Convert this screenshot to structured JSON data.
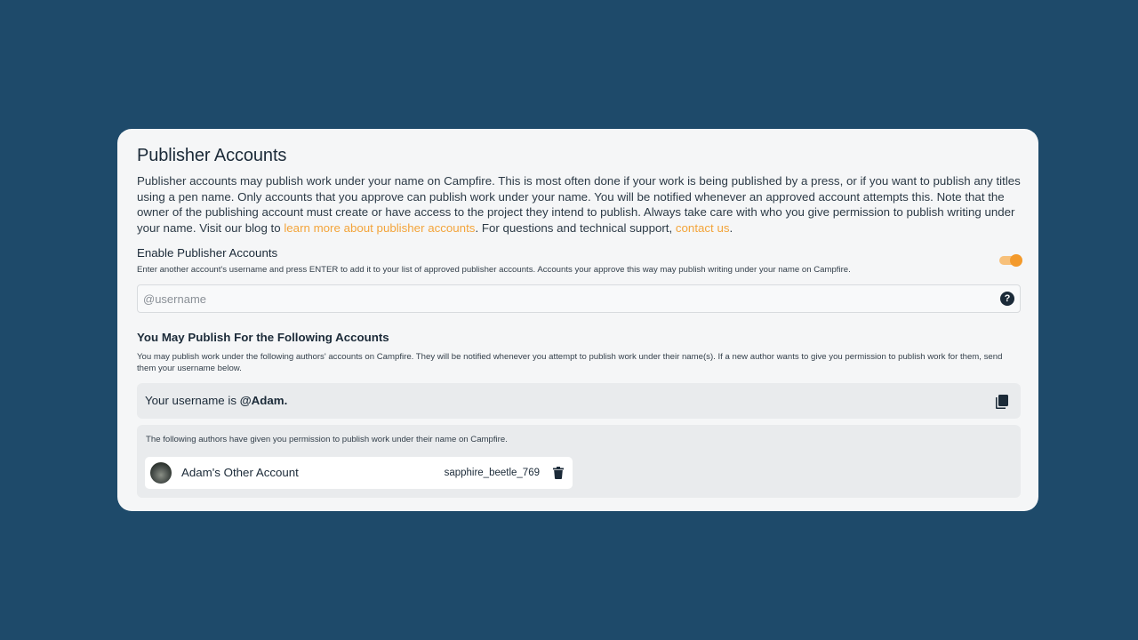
{
  "page": {
    "title": "Publisher Accounts",
    "intro_text": "Publisher accounts may publish work under your name on Campfire. This is most often done if your work is being published by a press, or if you want to publish any titles using a pen name. Only accounts that you approve can publish work under your name. You will be notified whenever an approved account attempts this. Note that the owner of the publishing account must create or have access to the project they intend to publish. Always take care with who you give permission to publish writing under your name. Visit our blog to ",
    "intro_link_blog": "learn more about publisher accounts",
    "intro_mid": ". For questions and technical support, ",
    "intro_link_contact": "contact us",
    "intro_end": "."
  },
  "enable_section": {
    "heading": "Enable Publisher Accounts",
    "description": "Enter another account's username and press ENTER to add it to your list of approved publisher accounts. Accounts your approve this way may publish writing under your name on Campfire.",
    "toggle_on": true,
    "input_placeholder": "@username",
    "input_value": "",
    "help_glyph": "?"
  },
  "publish_for_section": {
    "heading": "You May Publish For the Following Accounts",
    "description": "You may publish work under the following authors' accounts on Campfire. They will be notified whenever you attempt to publish work under their name(s). If a new author wants to give you permission to publish work for them, send them your username below.",
    "username_prefix": "Your username is ",
    "username": "@Adam.",
    "authors_note": "The following authors have given you permission to publish work under their name on Campfire.",
    "authors": [
      {
        "name": "Adam's Other Account",
        "handle": "sapphire_beetle_769"
      }
    ]
  },
  "colors": {
    "background": "#1e4a6a",
    "card": "#f5f6f7",
    "accent": "#f39a2c",
    "link": "#f3a43a",
    "text": "#1b2a38"
  },
  "icons": [
    "help-icon",
    "copy-icon",
    "trash-icon",
    "avatar"
  ]
}
